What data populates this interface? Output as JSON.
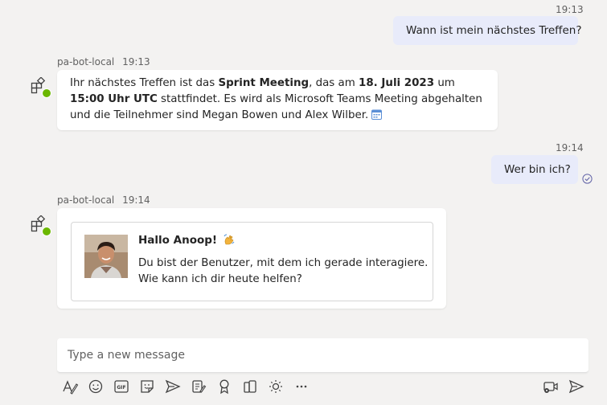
{
  "messages": {
    "user1": {
      "time": "19:13",
      "text": "Wann ist mein nächstes Treffen?"
    },
    "bot1": {
      "sender": "pa-bot-local",
      "time": "19:13",
      "seg1": "Ihr nächstes Treffen ist das ",
      "seg2": "Sprint Meeting",
      "seg3": ", das am ",
      "seg4": "18. Juli 2023",
      "seg5": " um ",
      "seg6": "15:00 Uhr UTC",
      "seg7": " stattfindet. Es wird als Microsoft Teams Meeting abgehalten und die Teilnehmer sind Megan Bowen und Alex Wilber. "
    },
    "user2": {
      "time": "19:14",
      "text": "Wer bin ich?"
    },
    "bot2": {
      "sender": "pa-bot-local",
      "time": "19:14",
      "card_title": "Hallo Anoop!",
      "card_line1": "Du bist der Benutzer, mit dem ich gerade interagiere.",
      "card_line2": "Wie kann ich dir heute helfen?"
    }
  },
  "compose": {
    "placeholder": "Type a new message"
  },
  "toolbar": {
    "icons": [
      "format-icon",
      "emoji-icon",
      "gif-icon",
      "sticker-icon",
      "schedule-send-icon",
      "loop-icon",
      "praise-icon",
      "apps-icon",
      "lightbulb-icon",
      "more-icon",
      "video-clip-icon",
      "send-icon"
    ]
  },
  "colors": {
    "accent": "#6264a7",
    "user_bubble": "#e8ebfa",
    "background": "#f3f2f1",
    "status_green": "#6bb700"
  }
}
